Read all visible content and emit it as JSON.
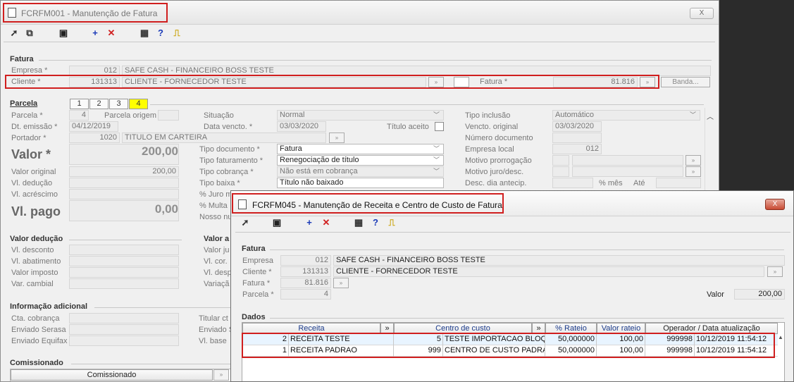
{
  "main": {
    "title": "FCRFM001 - Manutenção de Fatura",
    "close": "X",
    "fatura_section": "Fatura",
    "empresa_label": "Empresa *",
    "empresa_code": "012",
    "empresa_name": "SAFE CASH - FINANCEIRO BOSS TESTE",
    "cliente_label": "Cliente *",
    "cliente_code": "131313",
    "cliente_name": "CLIENTE - FORNECEDOR TESTE",
    "fatura_label": "Fatura *",
    "fatura_value": "81.816",
    "banda_label": "Banda...",
    "parcela_section": "Parcela",
    "tabs": [
      "1",
      "2",
      "3",
      "4"
    ],
    "parcela_label": "Parcela *",
    "parcela_value": "4",
    "parcela_origem_label": "Parcela origem",
    "dt_emissao_label": "Dt. emissão *",
    "dt_emissao_value": "04/12/2019",
    "portador_label": "Portador *",
    "portador_code": "1020",
    "portador_name": "TITULO EM CARTEIRA",
    "situacao_label": "Situação",
    "situacao_value": "Normal",
    "data_vencto_label": "Data vencto. *",
    "data_vencto_value": "03/03/2020",
    "titulo_aceito_label": "Título aceito",
    "tipo_doc_label": "Tipo documento *",
    "tipo_doc_value": "Fatura",
    "tipo_fat_label": "Tipo faturamento *",
    "tipo_fat_value": "Renegociação de título",
    "tipo_cob_label": "Tipo cobrança *",
    "tipo_cob_value": "Não está em cobrança",
    "tipo_baixa_label": "Tipo baixa *",
    "tipo_baixa_value": "Título não baixado",
    "juro_label": "% Juro m",
    "multa_label": "% Multa",
    "nosso_label": "Nosso nu",
    "tipo_inclusao_label": "Tipo inclusão",
    "tipo_inclusao_value": "Automático",
    "vencto_orig_label": "Vencto. original",
    "vencto_orig_value": "03/03/2020",
    "num_doc_label": "Número documento",
    "emp_local_label": "Empresa local",
    "emp_local_value": "012",
    "motivo_prorrog_label": "Motivo prorrogação",
    "motivo_juro_label": "Motivo juro/desc.",
    "desc_dia_label": "Desc. dia antecip.",
    "pct_mes_label": "% mês",
    "ate_label": "Até",
    "valor_label": "Valor *",
    "valor_value": "200,00",
    "valor_original_label": "Valor original",
    "valor_original_value": "200,00",
    "vl_deducao_label": "Vl. dedução",
    "vl_acrescimo_label": "Vl. acréscimo",
    "vl_pago_label": "Vl. pago",
    "vl_pago_value": "0,00",
    "valor_deducao_section": "Valor dedução",
    "vl_desconto_label": "Vl. desconto",
    "vl_abatimento_label": "Vl. abatimento",
    "valor_imposto_label": "Valor imposto",
    "var_cambial_label": "Var. cambial",
    "valor_a_section": "Valor a",
    "valor_ju_label": "Valor ju",
    "vl_cor_label": "Vl. cor.",
    "vl_desp_label": "Vl. desp",
    "variac_label": "Variaçã",
    "info_section": "Informação adicional",
    "cta_cob_label": "Cta. cobrança",
    "env_serasa_label": "Enviado Serasa",
    "env_equifax_label": "Enviado Equifax",
    "titular_label": "Titular ct",
    "enviado_s_label": "Enviado S",
    "vl_base_label": "Vl. base",
    "comissionado_section": "Comissionado",
    "comissionado_col": "Comissionado"
  },
  "dialog": {
    "title": "FCRFM045 - Manutenção de Receita e Centro de Custo de Fatura",
    "close": "X",
    "fatura_section": "Fatura",
    "empresa_label": "Empresa",
    "empresa_code": "012",
    "empresa_name": "SAFE CASH - FINANCEIRO BOSS TESTE",
    "cliente_label": "Cliente *",
    "cliente_code": "131313",
    "cliente_name": "CLIENTE - FORNECEDOR TESTE",
    "fatura_label": "Fatura *",
    "fatura_value": "81.816",
    "parcela_label": "Parcela *",
    "parcela_value": "4",
    "valor_label": "Valor",
    "valor_value": "200,00",
    "dados_section": "Dados",
    "columns": [
      "Receita",
      "»",
      "Centro de custo",
      "»",
      "% Rateio",
      "Valor rateio",
      "Operador / Data atualização"
    ],
    "rows": [
      {
        "rec_code": "2",
        "rec_name": "RECEITA TESTE",
        "cc_code": "5",
        "cc_name": "TESTE IMPORTACAO BLOQ",
        "rateio": "50,000000",
        "valor": "100,00",
        "operador": "999998",
        "data": "10/12/2019 11:54:12"
      },
      {
        "rec_code": "1",
        "rec_name": "RECEITA PADRAO",
        "cc_code": "999",
        "cc_name": "CENTRO DE CUSTO PADRAO",
        "rateio": "50,000000",
        "valor": "100,00",
        "operador": "999998",
        "data": "10/12/2019 11:54:12"
      }
    ]
  }
}
